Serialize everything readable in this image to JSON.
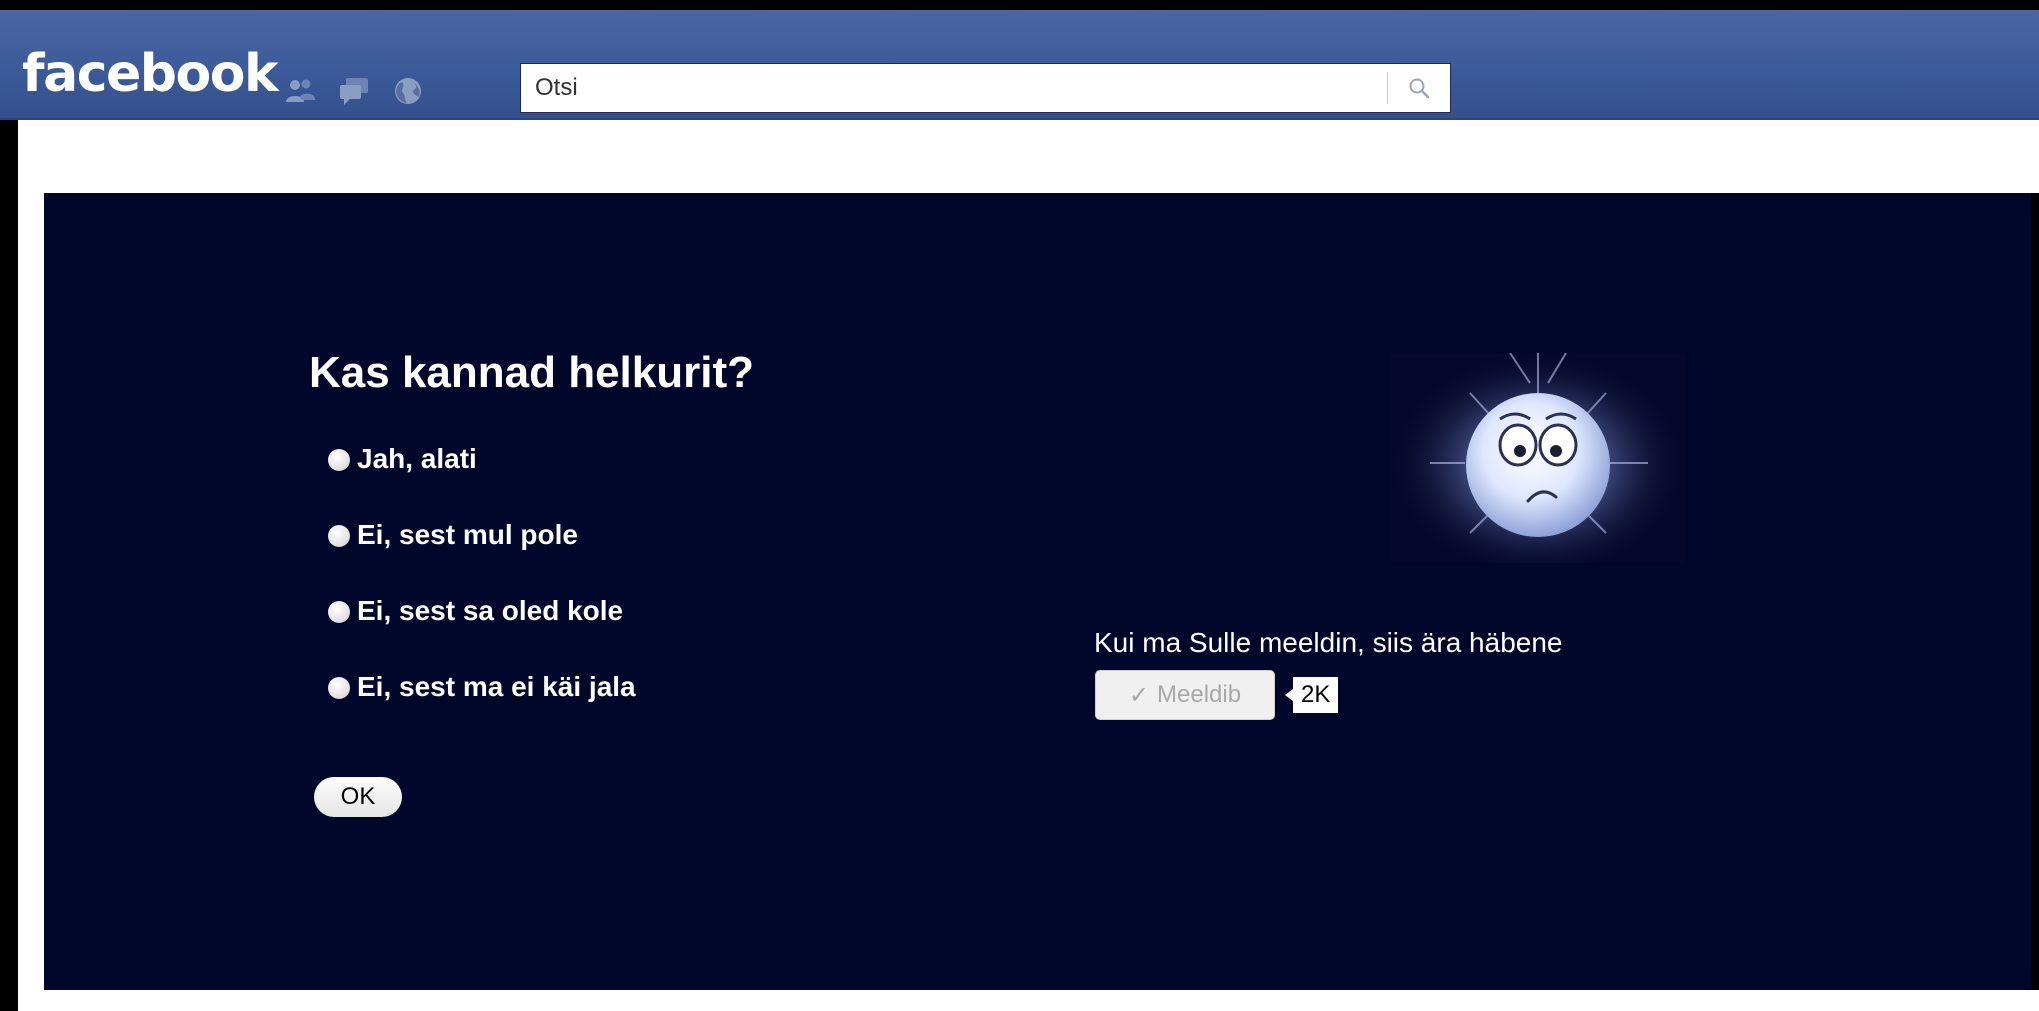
{
  "topbar": {
    "logo": "facebook",
    "jewels": [
      "friend-requests-icon",
      "messages-icon",
      "notifications-globe-icon"
    ],
    "search": {
      "placeholder": "Otsi",
      "value": ""
    },
    "color": "#3b5998"
  },
  "app": {
    "background": "#00072a",
    "question": "Kas kannad helkurit?",
    "options": [
      "Jah, alati",
      "Ei, sest mul pole",
      "Ei, sest sa oled kole",
      "Ei, sest ma ei käi jala"
    ],
    "ok_label": "OK",
    "image": "worried-glowing-moon-face",
    "like_text": "Kui ma Sulle meeldin, siis ära häbene",
    "like_button_label": "Meeldib",
    "like_count": "2K"
  }
}
